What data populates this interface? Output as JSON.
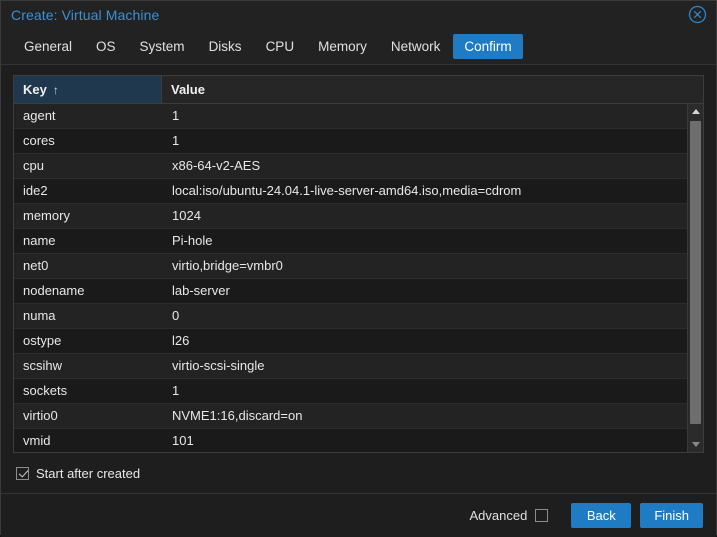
{
  "window": {
    "title": "Create: Virtual Machine",
    "close_icon": "close-circle-icon"
  },
  "tabs": [
    {
      "label": "General",
      "active": false
    },
    {
      "label": "OS",
      "active": false
    },
    {
      "label": "System",
      "active": false
    },
    {
      "label": "Disks",
      "active": false
    },
    {
      "label": "CPU",
      "active": false
    },
    {
      "label": "Memory",
      "active": false
    },
    {
      "label": "Network",
      "active": false
    },
    {
      "label": "Confirm",
      "active": true
    }
  ],
  "grid": {
    "columns": [
      {
        "label": "Key",
        "sorted": true,
        "sort_direction": "↑"
      },
      {
        "label": "Value",
        "sorted": false,
        "sort_direction": ""
      }
    ],
    "rows": [
      {
        "key": "agent",
        "value": "1"
      },
      {
        "key": "cores",
        "value": "1"
      },
      {
        "key": "cpu",
        "value": "x86-64-v2-AES"
      },
      {
        "key": "ide2",
        "value": "local:iso/ubuntu-24.04.1-live-server-amd64.iso,media=cdrom"
      },
      {
        "key": "memory",
        "value": "1024"
      },
      {
        "key": "name",
        "value": "Pi-hole"
      },
      {
        "key": "net0",
        "value": "virtio,bridge=vmbr0"
      },
      {
        "key": "nodename",
        "value": "lab-server"
      },
      {
        "key": "numa",
        "value": "0"
      },
      {
        "key": "ostype",
        "value": "l26"
      },
      {
        "key": "scsihw",
        "value": "virtio-scsi-single"
      },
      {
        "key": "sockets",
        "value": "1"
      },
      {
        "key": "virtio0",
        "value": "NVME1:16,discard=on"
      },
      {
        "key": "vmid",
        "value": "101"
      }
    ],
    "scrollbar": {
      "up_icon": "triangle-up-icon",
      "down_icon": "triangle-down-icon"
    }
  },
  "options": {
    "start_after_created": {
      "label": "Start after created",
      "checked": true
    }
  },
  "footer": {
    "advanced": {
      "label": "Advanced",
      "checked": false
    },
    "back_label": "Back",
    "finish_label": "Finish"
  },
  "colors": {
    "accent": "#1f7cc4",
    "title": "#3c90d4",
    "sorted_column": "#1f384d",
    "window_bg": "#1e1e1e"
  }
}
